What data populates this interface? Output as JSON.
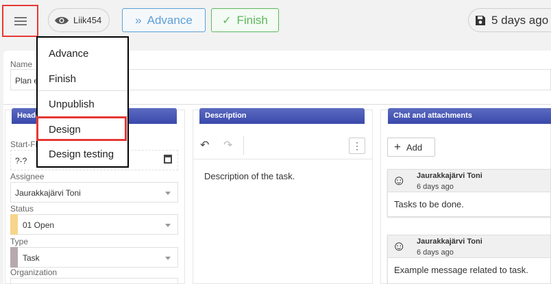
{
  "toolbar": {
    "user_label": "Liik454",
    "advance_label": "Advance",
    "finish_label": "Finish",
    "saved_label": "5 days ago"
  },
  "menu": {
    "items": [
      {
        "label": "Advance"
      },
      {
        "label": "Finish"
      },
      {
        "label": "Unpublish"
      },
      {
        "label": "Design"
      },
      {
        "label": "Design testing"
      }
    ],
    "highlighted": "Design"
  },
  "name_field": {
    "label": "Name",
    "value": "Plan e"
  },
  "header_panel": {
    "title": "Heade",
    "start_label": "Start-Fi",
    "start_value": "?-?",
    "assignee_label": "Assignee",
    "assignee_value": "Jaurakkajärvi Toni",
    "status_label": "Status",
    "status_value": "01 Open",
    "status_color": "#f7d58a",
    "type_label": "Type",
    "type_value": "Task",
    "type_color": "#b7a9ad",
    "org_label": "Organization"
  },
  "description_panel": {
    "title": "Description",
    "text": "Description of the task."
  },
  "chat_panel": {
    "title": "Chat and attachments",
    "add_label": "Add",
    "messages": [
      {
        "author": "Jaurakkajärvi Toni",
        "time": "6 days ago",
        "text": "Tasks to be done."
      },
      {
        "author": "Jaurakkajärvi Toni",
        "time": "6 days ago",
        "text": "Example message related to task."
      }
    ]
  },
  "colors": {
    "accent_red": "#e53935",
    "advance_blue": "#5b9fd6",
    "finish_green": "#5cb85c",
    "header_indigo": "#3f51b5"
  }
}
